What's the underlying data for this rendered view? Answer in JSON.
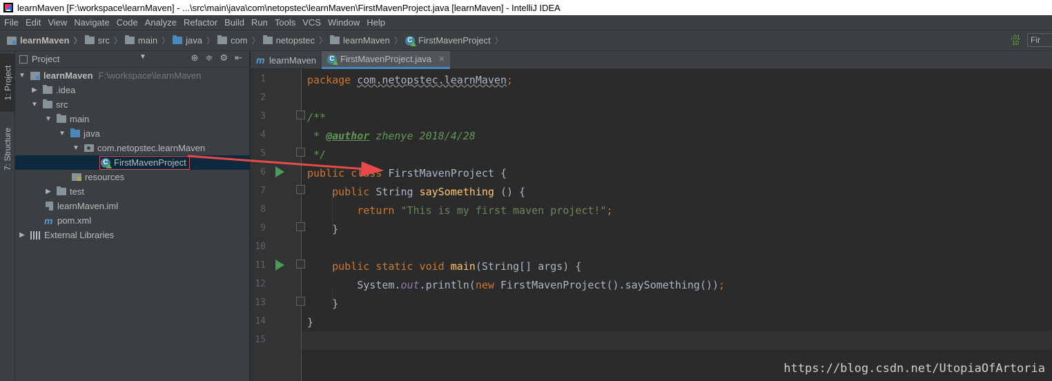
{
  "window": {
    "title": "learnMaven [F:\\workspace\\learnMaven] - ...\\src\\main\\java\\com\\netopstec\\learnMaven\\FirstMavenProject.java [learnMaven] - IntelliJ IDEA"
  },
  "menu": [
    "File",
    "Edit",
    "View",
    "Navigate",
    "Code",
    "Analyze",
    "Refactor",
    "Build",
    "Run",
    "Tools",
    "VCS",
    "Window",
    "Help"
  ],
  "breadcrumb": {
    "items": [
      {
        "label": "learnMaven",
        "icon": "module-icon"
      },
      {
        "label": "src",
        "icon": "folder-icon"
      },
      {
        "label": "main",
        "icon": "folder-icon"
      },
      {
        "label": "java",
        "icon": "source-folder-icon"
      },
      {
        "label": "com",
        "icon": "package-icon"
      },
      {
        "label": "netopstec",
        "icon": "package-icon"
      },
      {
        "label": "learnMaven",
        "icon": "package-icon"
      },
      {
        "label": "FirstMavenProject",
        "icon": "class-icon"
      }
    ],
    "run_config_label": "Fir"
  },
  "left_tool_strip": {
    "project_tab": "1: Project",
    "structure_tab": "7: Structure"
  },
  "project_panel": {
    "title": "Project",
    "tree": [
      {
        "label": "learnMaven",
        "path": "F:\\workspace\\learnMaven",
        "bold": true,
        "arrow": "expanded",
        "icon": "module-icon"
      },
      {
        "label": ".idea",
        "arrow": "collapsed",
        "icon": "folder-icon"
      },
      {
        "label": "src",
        "arrow": "expanded",
        "icon": "folder-icon"
      },
      {
        "label": "main",
        "arrow": "expanded",
        "icon": "folder-icon"
      },
      {
        "label": "java",
        "arrow": "expanded",
        "icon": "source-folder-icon"
      },
      {
        "label": "com.netopstec.learnMaven",
        "arrow": "expanded",
        "icon": "package-icon"
      },
      {
        "label": "FirstMavenProject",
        "icon": "class-icon",
        "selected": true
      },
      {
        "label": "resources",
        "icon": "resources-folder-icon"
      },
      {
        "label": "test",
        "arrow": "collapsed",
        "icon": "folder-icon"
      },
      {
        "label": "learnMaven.iml",
        "icon": "iml-file-icon"
      },
      {
        "label": "pom.xml",
        "icon": "maven-icon"
      },
      {
        "label": "External Libraries",
        "arrow": "collapsed",
        "icon": "library-icon"
      }
    ]
  },
  "editor_tabs": [
    {
      "label": "learnMaven",
      "icon": "maven-icon",
      "active": false
    },
    {
      "label": "FirstMavenProject.java",
      "icon": "class-icon",
      "active": true
    }
  ],
  "editor": {
    "line_numbers": [
      "1",
      "2",
      "3",
      "4",
      "5",
      "6",
      "7",
      "8",
      "9",
      "10",
      "11",
      "12",
      "13",
      "14",
      "15"
    ],
    "code": {
      "l1_kw": "package ",
      "l1_pkg": "com.netopstec.learnMaven",
      "l1_end": ";",
      "l3": "/**",
      "l4_pre": " * ",
      "l4_tag": "@author",
      "l4_rest": " zhenye 2018/4/28",
      "l5": " */",
      "l6_kw": "public class ",
      "l6_name": "FirstMavenProject {",
      "l7_kw": "    public ",
      "l7_type": "String ",
      "l7_fn": "saySomething",
      "l7_rest": " () {",
      "l8_kw": "        return ",
      "l8_str": "\"This is my first maven project!\"",
      "l8_end": ";",
      "l9": "    }",
      "l11_kw": "    public static void ",
      "l11_fn": "main",
      "l11_rest": "(String[] args) {",
      "l12_a": "        System.",
      "l12_out": "out",
      "l12_b": ".println(",
      "l12_kw": "new ",
      "l12_c": "FirstMavenProject().saySomething())",
      "l12_end": ";",
      "l13": "    }",
      "l14": "}"
    }
  },
  "watermark": "https://blog.csdn.net/UtopiaOfArtoria",
  "colors": {
    "annotation_arrow": "#e84a4a",
    "selection": "#0d293e",
    "keyword": "#cc7832",
    "string": "#6a8759",
    "comment": "#629755"
  }
}
